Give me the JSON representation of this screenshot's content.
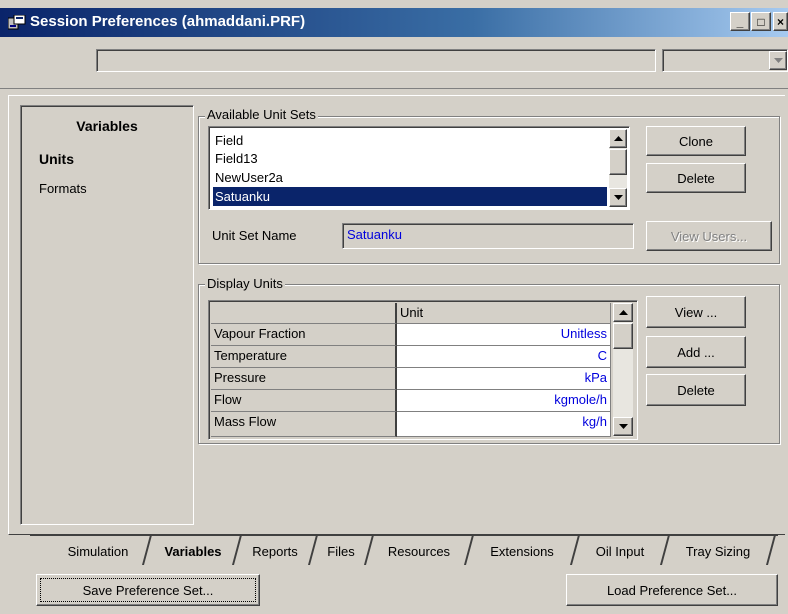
{
  "window": {
    "title": "Session Preferences (ahmaddani.PRF)",
    "controls": {
      "minimize": "_",
      "maximize": "□",
      "close": "×"
    }
  },
  "sidebar": {
    "header": "Variables",
    "items": [
      {
        "label": "Units",
        "selected": true
      },
      {
        "label": "Formats",
        "selected": false
      }
    ]
  },
  "unit_sets": {
    "group_label": "Available Unit Sets",
    "items": [
      {
        "label": "Field",
        "selected": false
      },
      {
        "label": "Field13",
        "selected": false
      },
      {
        "label": "NewUser2a",
        "selected": false
      },
      {
        "label": "Satuanku",
        "selected": true
      }
    ],
    "clone_label": "Clone",
    "delete_label": "Delete",
    "view_users_label": "View Users...",
    "name_label": "Unit Set Name",
    "name_value": "Satuanku"
  },
  "display_units": {
    "group_label": "Display Units",
    "column_header": "Unit",
    "rows": [
      {
        "variable": "Vapour Fraction",
        "unit": "Unitless"
      },
      {
        "variable": "Temperature",
        "unit": "C"
      },
      {
        "variable": "Pressure",
        "unit": "kPa"
      },
      {
        "variable": "Flow",
        "unit": "kgmole/h"
      },
      {
        "variable": "Mass Flow",
        "unit": "kg/h"
      }
    ],
    "view_label": "View ...",
    "add_label": "Add ...",
    "delete_label": "Delete"
  },
  "tabs": [
    {
      "label": "Simulation",
      "active": false
    },
    {
      "label": "Variables",
      "active": true
    },
    {
      "label": "Reports",
      "active": false
    },
    {
      "label": "Files",
      "active": false
    },
    {
      "label": "Resources",
      "active": false
    },
    {
      "label": "Extensions",
      "active": false
    },
    {
      "label": "Oil Input",
      "active": false
    },
    {
      "label": "Tray Sizing",
      "active": false
    }
  ],
  "footer": {
    "save_label": "Save Preference Set...",
    "load_label": "Load Preference Set..."
  },
  "colors": {
    "selection": "#0a246a",
    "unit_text": "#0000dd",
    "face": "#d4d0c8"
  }
}
